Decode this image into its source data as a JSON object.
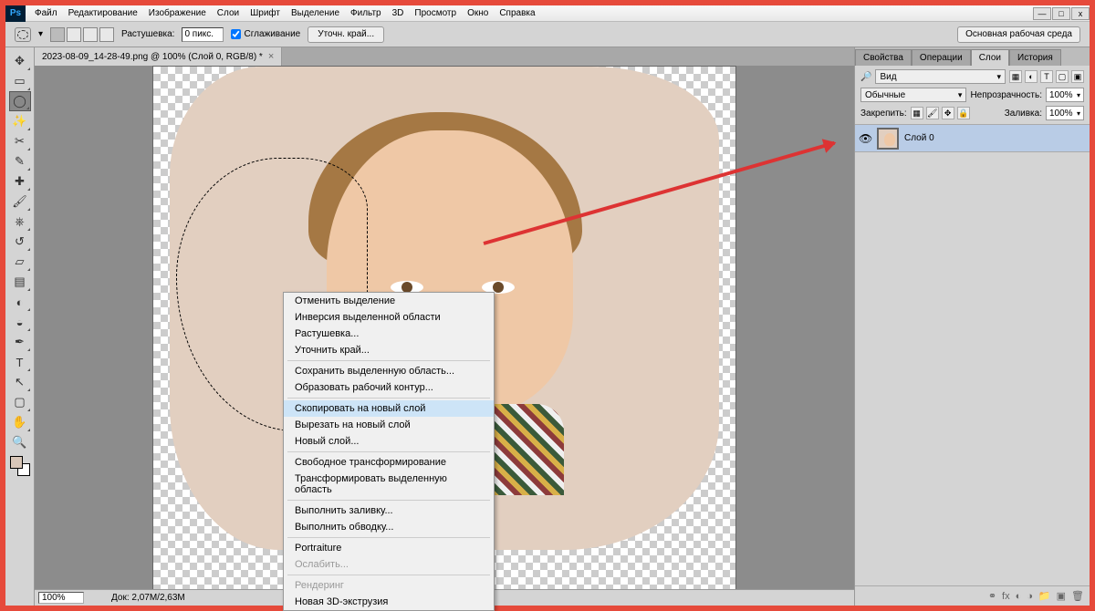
{
  "app": {
    "logo": "Ps"
  },
  "menu": [
    "Файл",
    "Редактирование",
    "Изображение",
    "Слои",
    "Шрифт",
    "Выделение",
    "Фильтр",
    "3D",
    "Просмотр",
    "Окно",
    "Справка"
  ],
  "options": {
    "feather_label": "Растушевка:",
    "feather_value": "0 пикс.",
    "antialias_label": "Сглаживание",
    "refine_btn": "Уточн. край...",
    "workspace": "Основная рабочая среда"
  },
  "document": {
    "tab_title": "2023-08-09_14-28-49.png @ 100% (Слой 0, RGB/8) *"
  },
  "context_menu": {
    "items": [
      {
        "label": "Отменить выделение",
        "sep": false
      },
      {
        "label": "Инверсия выделенной области",
        "sep": false
      },
      {
        "label": "Растушевка...",
        "sep": false
      },
      {
        "label": "Уточнить край...",
        "sep": true
      },
      {
        "label": "Сохранить выделенную область...",
        "sep": false
      },
      {
        "label": "Образовать рабочий контур...",
        "sep": true
      },
      {
        "label": "Скопировать на новый слой",
        "sep": false,
        "hl": true
      },
      {
        "label": "Вырезать на новый слой",
        "sep": false
      },
      {
        "label": "Новый слой...",
        "sep": true
      },
      {
        "label": "Свободное трансформирование",
        "sep": false
      },
      {
        "label": "Трансформировать выделенную область",
        "sep": true
      },
      {
        "label": "Выполнить заливку...",
        "sep": false
      },
      {
        "label": "Выполнить обводку...",
        "sep": true
      },
      {
        "label": "Portraiture",
        "sep": false
      },
      {
        "label": "Ослабить...",
        "sep": true,
        "disabled": true
      },
      {
        "label": "Рендеринг",
        "sep": false,
        "disabled": true
      },
      {
        "label": "Новая 3D-экструзия",
        "sep": false
      }
    ]
  },
  "status": {
    "zoom": "100%",
    "doc_size": "Док: 2,07M/2,63M"
  },
  "panels": {
    "tabs": [
      "Свойства",
      "Операции",
      "Слои",
      "История"
    ],
    "active_tab": "Слои",
    "kind_label": "Вид",
    "blend_mode": "Обычные",
    "opacity_label": "Непрозрачность:",
    "opacity_value": "100%",
    "lock_label": "Закрепить:",
    "fill_label": "Заливка:",
    "fill_value": "100%",
    "layer0": "Слой 0"
  },
  "winbtns": {
    "min": "—",
    "max": "□",
    "close": "x"
  }
}
